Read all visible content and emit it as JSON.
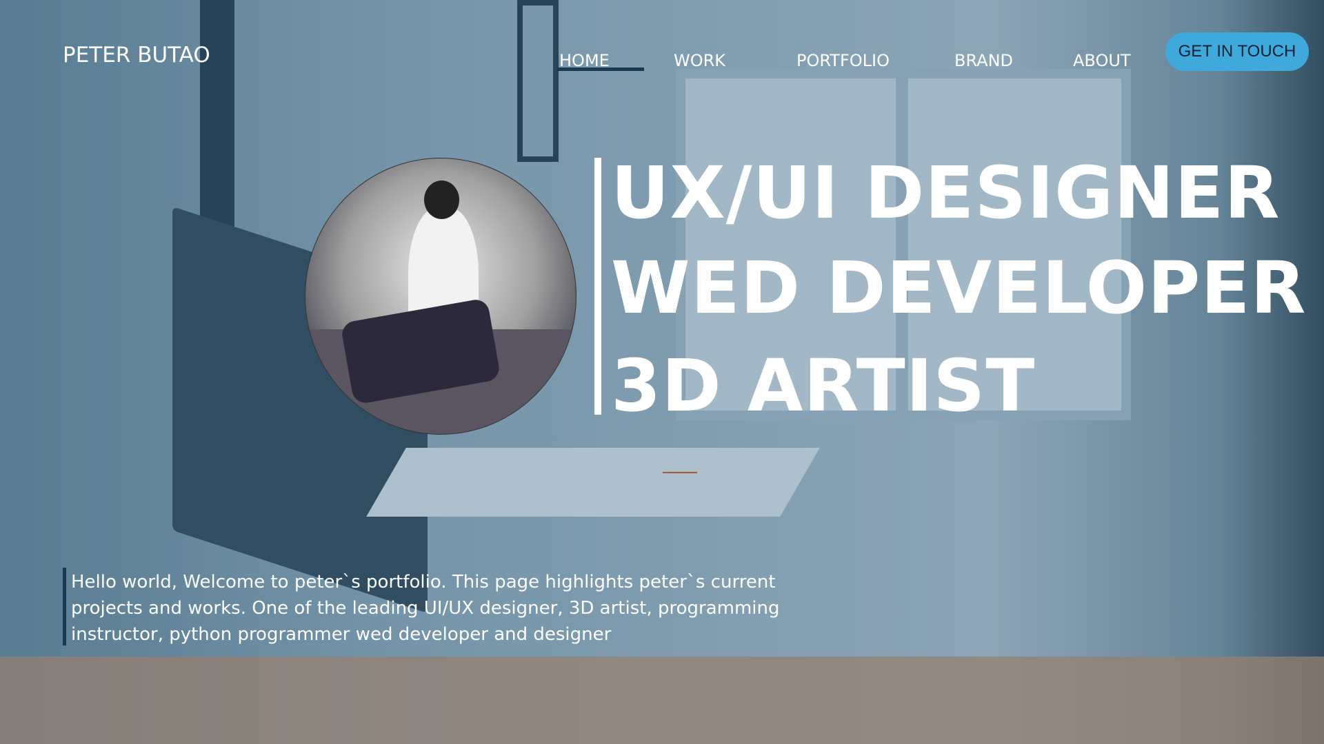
{
  "header": {
    "logo": "PETER BUTAO",
    "nav": [
      "HOME",
      "WORK",
      "PORTFOLIO",
      "BRAND",
      "ABOUT"
    ],
    "active": "HOME",
    "cta": "GET IN TOUCH"
  },
  "hero": {
    "lines": [
      "UX/UI DESIGNER",
      "WED DEVELOPER",
      "3D ARTIST"
    ],
    "intro": "Hello world, Welcome to peter`s portfolio. This page highlights peter`s current projects and works. One of the  leading UI/UX designer, 3D artist, programming instructor, python programmer wed developer and designer"
  },
  "colors": {
    "accent": "#3fa9dc",
    "dark": "#173a52"
  }
}
